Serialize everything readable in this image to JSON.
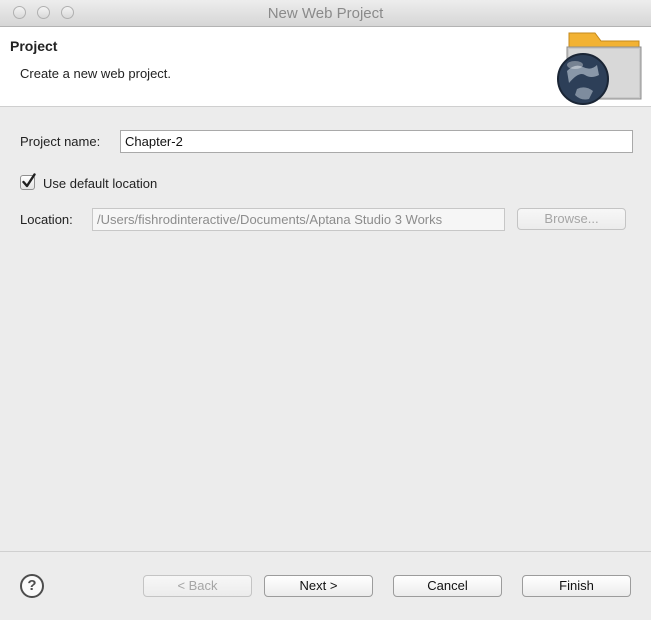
{
  "window": {
    "title": "New Web Project"
  },
  "banner": {
    "title": "Project",
    "description": "Create a new web project.",
    "icon": "globe-folder-icon"
  },
  "form": {
    "project_name_label": "Project name:",
    "project_name_value": "Chapter-2",
    "use_default_location_label": "Use default location",
    "use_default_location_checked": true,
    "location_label": "Location:",
    "location_value": "/Users/fishrodinteractive/Documents/Aptana Studio 3 Works",
    "browse_label": "Browse..."
  },
  "footer": {
    "help_label": "?",
    "back_label": "< Back",
    "next_label": "Next >",
    "cancel_label": "Cancel",
    "finish_label": "Finish"
  },
  "colors": {
    "background": "#ececec",
    "banner": "#ffffff",
    "folder": "#f2b233"
  }
}
